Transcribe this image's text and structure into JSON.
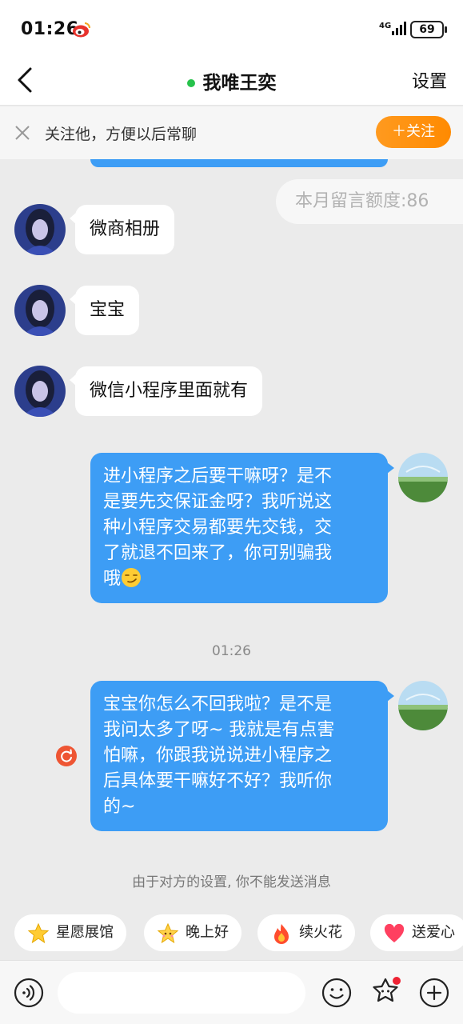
{
  "status_bar": {
    "time": "01:26",
    "network": "4G",
    "battery": "69"
  },
  "header": {
    "back_label": "<",
    "title": "我唯王奕",
    "settings_label": "设置"
  },
  "follow_bar": {
    "text": "关注他，方便以后常聊",
    "button_label": "＋关注"
  },
  "chat": {
    "quota_text": "本月留言额度:86",
    "incoming": [
      {
        "text": "微商相册"
      },
      {
        "text": "宝宝"
      },
      {
        "text": "微信小程序里面就有"
      }
    ],
    "outgoing_1": {
      "lines": [
        "进小程序之后要干嘛呀？是不",
        "是要先交保证金呀？我听说这",
        "种小程序交易都要先交钱，交",
        "了就退不回来了，你可别骗我",
        "哦"
      ]
    },
    "timestamp": "01:26",
    "outgoing_2": {
      "lines": [
        "宝宝你怎么不回我啦？是不是",
        "我问太多了呀~ 我就是有点害",
        "怕嘛，你跟我说说进小程序之",
        "后具体要干嘛好不好？我听你",
        "的~"
      ]
    },
    "notice": "由于对方的设置, 你不能发送消息"
  },
  "quick_actions": [
    {
      "label": "星愿展馆",
      "icon": "star-icon"
    },
    {
      "label": "晚上好",
      "icon": "star-face-icon"
    },
    {
      "label": "续火花",
      "icon": "fire-icon"
    },
    {
      "label": "送爱心",
      "icon": "heart-icon"
    }
  ],
  "input_bar": {
    "placeholder": ""
  },
  "colors": {
    "accent_blue": "#3d9df5",
    "follow_orange": "#ff9a1f",
    "online_green": "#27c24c"
  }
}
